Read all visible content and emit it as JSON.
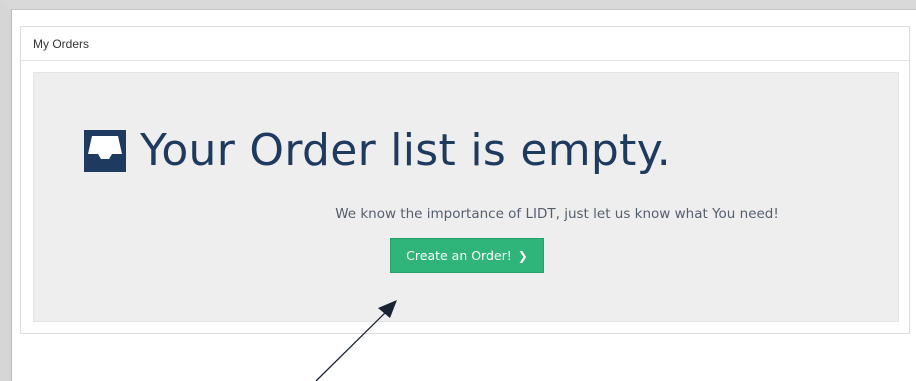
{
  "panel": {
    "title": "My Orders"
  },
  "empty_state": {
    "icon": "inbox-icon",
    "headline": "Your Order list is empty.",
    "subtext": "We know the importance of LIDT, just let us know what You need!",
    "button_label": "Create an Order!",
    "button_icon": "chevron-right-icon",
    "button_glyph": "❯"
  },
  "colors": {
    "headline": "#1e3a5f",
    "button": "#2fb57a",
    "empty_bg": "#eeeeee"
  }
}
